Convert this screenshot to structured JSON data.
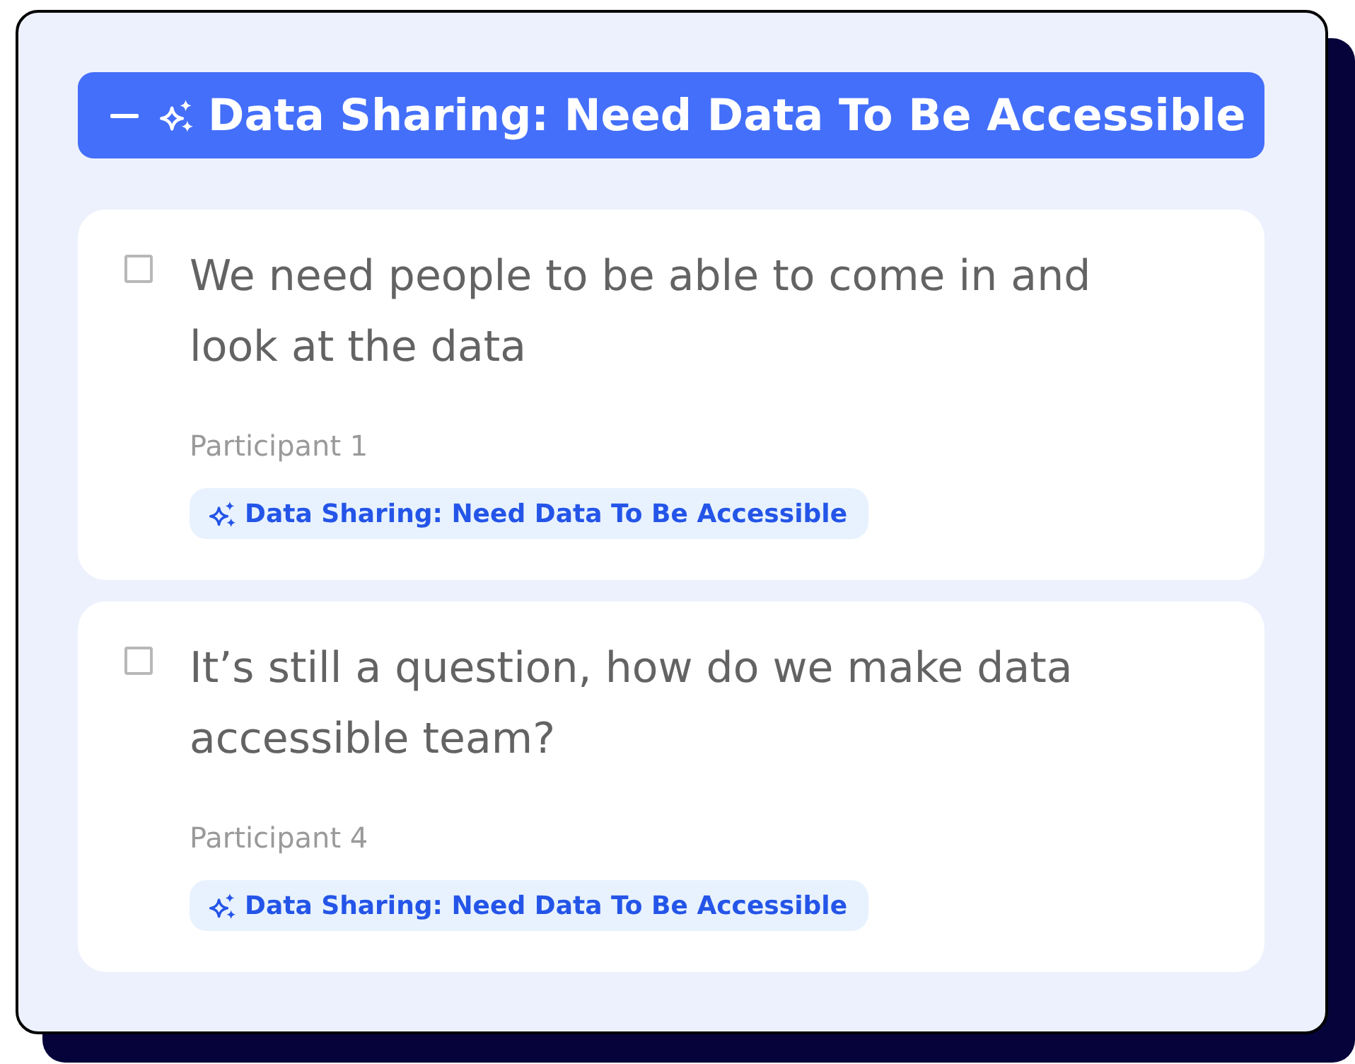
{
  "group": {
    "title": "Data Sharing: Need Data To Be Accessible",
    "expanded": true
  },
  "quotes": [
    {
      "text": "We need people to be able to come in and look at the data",
      "checked": false,
      "participant": "Participant 1",
      "tag": "Data Sharing: Need Data To Be Accessible"
    },
    {
      "text": "It’s still a question, how do we make data accessible team?",
      "checked": false,
      "participant": "Participant 4",
      "tag": "Data Sharing: Need Data To Be Accessible"
    }
  ]
}
